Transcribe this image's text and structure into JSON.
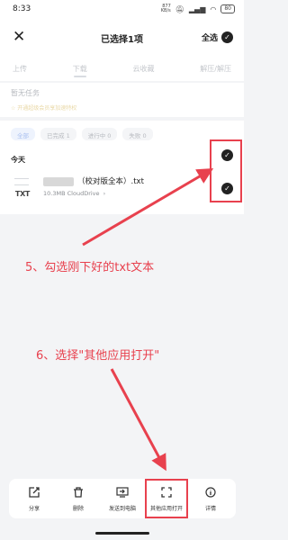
{
  "status_bar": {
    "time": "8:33",
    "speed_value": "877",
    "speed_unit": "KB/s",
    "battery": "80"
  },
  "header": {
    "close_icon": "close-icon",
    "title": "已选择1项",
    "select_all_label": "全选"
  },
  "tabs": [
    {
      "label": "上传"
    },
    {
      "label": "下载",
      "active": true
    },
    {
      "label": "云收藏"
    },
    {
      "label": "解压/解压"
    }
  ],
  "notice": {
    "title": "暂无任务",
    "hint": "☆ 开通超级会员享加速特权"
  },
  "filters": [
    {
      "label": "全部",
      "active": true
    },
    {
      "label": "已完成 1"
    },
    {
      "label": "进行中 0"
    },
    {
      "label": "失败 0"
    }
  ],
  "list": {
    "section_title": "今天",
    "file": {
      "icon_ext": "TXT",
      "name": "（校对版全本）.txt",
      "size": "10.3MB",
      "location": "CloudDrive",
      "chevron": "›"
    }
  },
  "annotations": {
    "step5": "5、勾选刚下好的txt文本",
    "step6": "6、选择\"其他应用打开\""
  },
  "actions": [
    {
      "label": "分享",
      "icon": "share-icon"
    },
    {
      "label": "删除",
      "icon": "trash-icon"
    },
    {
      "label": "发送到电脑",
      "icon": "send-to-pc-icon"
    },
    {
      "label": "其他应用打开",
      "icon": "open-with-icon",
      "highlighted": true
    },
    {
      "label": "详情",
      "icon": "info-icon"
    }
  ],
  "colors": {
    "annotation_red": "#e8414e",
    "check_dark": "#222222"
  }
}
